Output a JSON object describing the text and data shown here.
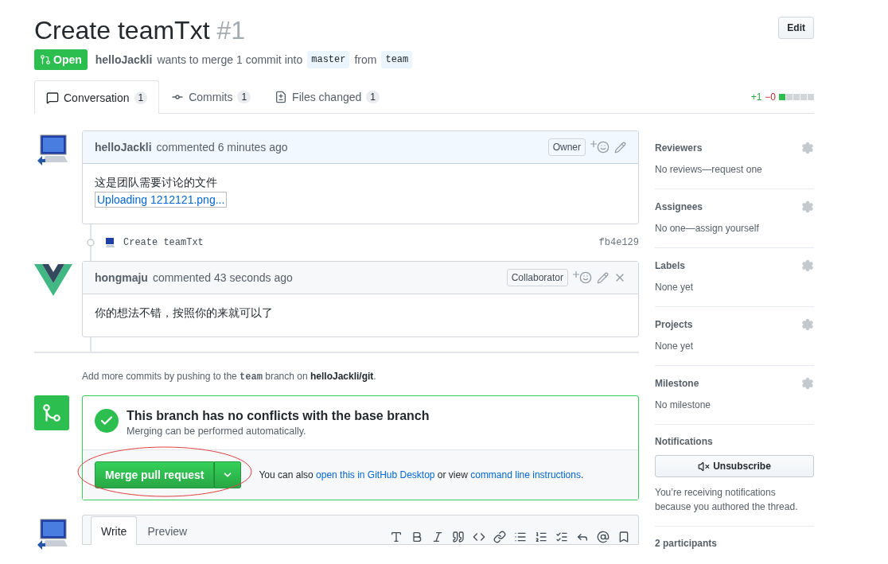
{
  "title": "Create teamTxt",
  "number": "#1",
  "state": {
    "label": "Open",
    "kind": "open"
  },
  "summary": {
    "author": "helloJackli",
    "text": "wants to merge 1 commit into",
    "base": "master",
    "joiner": "from",
    "head": "team"
  },
  "edit_button": "Edit",
  "tabs": [
    {
      "label": "Conversation",
      "count": "1",
      "selected": true
    },
    {
      "label": "Commits",
      "count": "1",
      "selected": false
    },
    {
      "label": "Files changed",
      "count": "1",
      "selected": false
    }
  ],
  "diffstat": {
    "added": "+1",
    "removed": "−0"
  },
  "timeline": [
    {
      "kind": "comment",
      "author": "helloJackli",
      "action": "commented 6 minutes ago",
      "role": "Owner",
      "highlighted": true,
      "deletable": false,
      "text": "这是团队需要讨论的文件",
      "link": "Uploading 1212121.png..."
    },
    {
      "kind": "commit",
      "message": "Create teamTxt",
      "sha": "fb4e129"
    },
    {
      "kind": "comment",
      "author": "hongmaju",
      "action": "commented 43 seconds ago",
      "role": "Collaborator",
      "highlighted": false,
      "deletable": true,
      "text": "你的想法不错，按照你的来就可以了"
    }
  ],
  "merge": {
    "hint": [
      {
        "kind": "text",
        "text": "Add more commits by pushing to the "
      },
      {
        "kind": "code",
        "text": "team"
      },
      {
        "kind": "text",
        "text": " branch on "
      },
      {
        "kind": "strong",
        "text": "helloJackli/git"
      },
      {
        "kind": "text",
        "text": "."
      }
    ],
    "status_title": "This branch has no conflicts with the base branch",
    "status_subtitle": "Merging can be performed automatically.",
    "button": "Merge pull request",
    "also": [
      {
        "kind": "text",
        "text": "You can also "
      },
      {
        "kind": "link",
        "text": "open this in GitHub Desktop"
      },
      {
        "kind": "text",
        "text": " or view "
      },
      {
        "kind": "link",
        "text": "command line instructions"
      },
      {
        "kind": "text",
        "text": "."
      }
    ]
  },
  "composer": {
    "tabs": [
      {
        "label": "Write",
        "selected": true
      },
      {
        "label": "Preview",
        "selected": false
      }
    ]
  },
  "sidebar": [
    {
      "kind": "field",
      "title": "Reviewers",
      "value": "No reviews—request one"
    },
    {
      "kind": "field",
      "title": "Assignees",
      "value": "No one—assign yourself"
    },
    {
      "kind": "field",
      "title": "Labels",
      "value": "None yet"
    },
    {
      "kind": "field",
      "title": "Projects",
      "value": "None yet"
    },
    {
      "kind": "field",
      "title": "Milestone",
      "value": "No milestone"
    },
    {
      "kind": "notifications",
      "title": "Notifications",
      "button": "Unsubscribe",
      "value": "You’re receiving notifications because you authored the thread."
    },
    {
      "kind": "plain",
      "title": "2 participants"
    }
  ]
}
